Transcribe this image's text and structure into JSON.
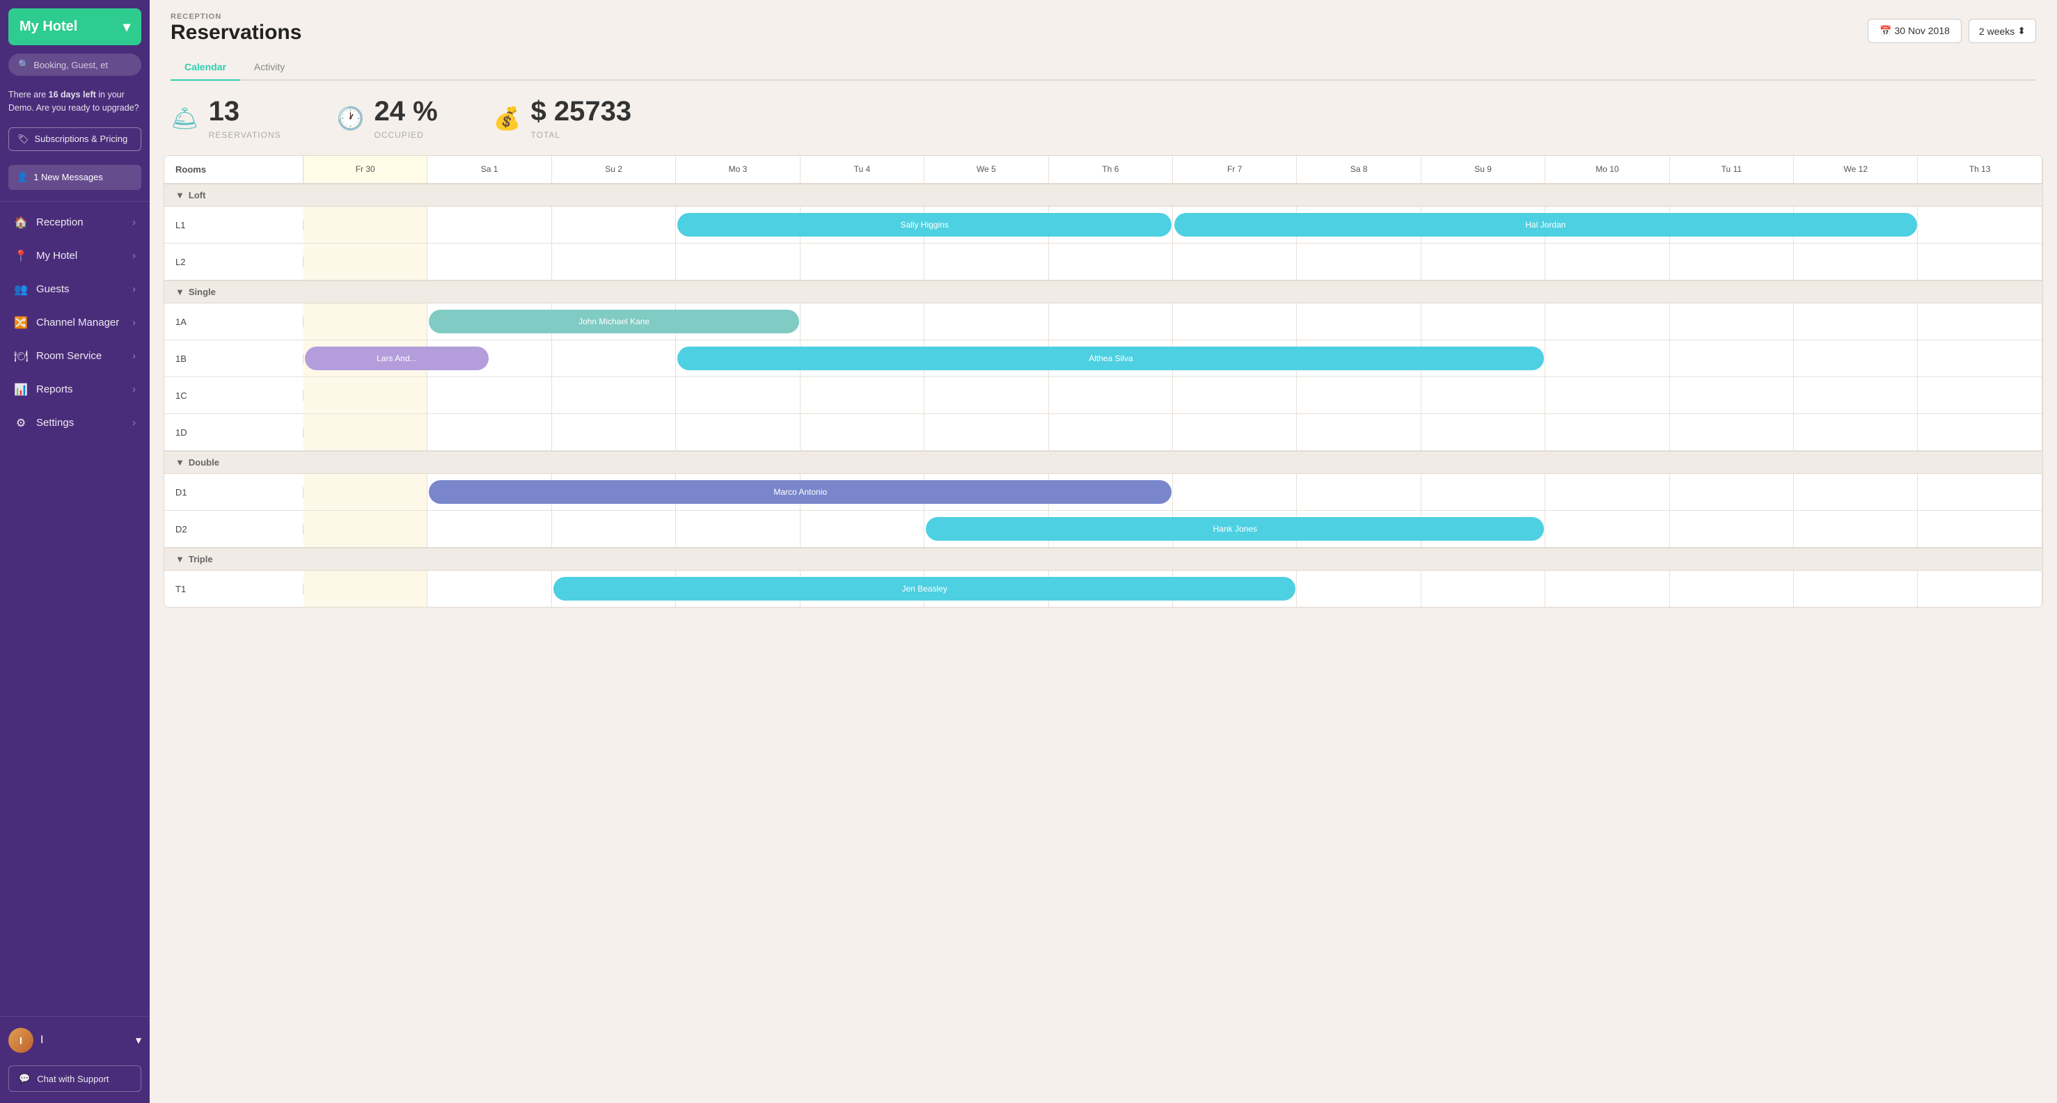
{
  "sidebar": {
    "hotel_name": "My Hotel",
    "search_placeholder": "Booking, Guest, et",
    "demo_notice": "There are ",
    "demo_days": "16 days left",
    "demo_suffix": " in your Demo. Are you ready to upgrade?",
    "subscriptions_label": "Subscriptions & Pricing",
    "messages_label": "1 New Messages",
    "nav_items": [
      {
        "id": "reception",
        "label": "Reception",
        "icon": "🏠"
      },
      {
        "id": "my-hotel",
        "label": "My Hotel",
        "icon": "📍"
      },
      {
        "id": "guests",
        "label": "Guests",
        "icon": "👥"
      },
      {
        "id": "channel-manager",
        "label": "Channel Manager",
        "icon": "🔀"
      },
      {
        "id": "room-service",
        "label": "Room Service",
        "icon": "🍽"
      },
      {
        "id": "reports",
        "label": "Reports",
        "icon": "📊"
      },
      {
        "id": "settings",
        "label": "Settings",
        "icon": "⚙"
      }
    ],
    "user_label": "I",
    "chat_support_label": "Chat with Support"
  },
  "header": {
    "section_label": "RECEPTION",
    "page_title": "Reservations",
    "date_value": "30 Nov 2018",
    "week_value": "2 weeks"
  },
  "tabs": [
    {
      "id": "calendar",
      "label": "Calendar",
      "active": true
    },
    {
      "id": "activity",
      "label": "Activity",
      "active": false
    }
  ],
  "stats": {
    "reservations_count": "13",
    "reservations_label": "RESERVATIONS",
    "occupied_percent": "24 %",
    "occupied_label": "OCCUPIED",
    "total_amount": "$ 25733",
    "total_label": "TOTAL"
  },
  "calendar": {
    "rooms_header": "Rooms",
    "days": [
      {
        "label": "Fr 30",
        "today": true
      },
      {
        "label": "Sa 1",
        "today": false
      },
      {
        "label": "Su 2",
        "today": false
      },
      {
        "label": "Mo 3",
        "today": false
      },
      {
        "label": "Tu 4",
        "today": false
      },
      {
        "label": "We 5",
        "today": false
      },
      {
        "label": "Th 6",
        "today": false
      },
      {
        "label": "Fr 7",
        "today": false
      },
      {
        "label": "Sa 8",
        "today": false
      },
      {
        "label": "Su 9",
        "today": false
      },
      {
        "label": "Mo 10",
        "today": false
      },
      {
        "label": "Tu 11",
        "today": false
      },
      {
        "label": "We 12",
        "today": false
      },
      {
        "label": "Th 13",
        "today": false
      }
    ],
    "groups": [
      {
        "name": "Loft",
        "rooms": [
          {
            "id": "L1",
            "bookings": [
              {
                "guest": "Sally Higgins",
                "start": 3,
                "span": 4,
                "color": "booking-cyan"
              },
              {
                "guest": "Hal Jordan",
                "start": 7,
                "span": 6,
                "color": "booking-cyan"
              }
            ]
          },
          {
            "id": "L2",
            "bookings": []
          }
        ]
      },
      {
        "name": "Single",
        "rooms": [
          {
            "id": "1A",
            "bookings": [
              {
                "guest": "John Michael Kane",
                "start": 1,
                "span": 3,
                "color": "booking-green"
              }
            ]
          },
          {
            "id": "1B",
            "bookings": [
              {
                "guest": "Lars And...",
                "start": 0,
                "span": 1.5,
                "color": "booking-lavender"
              },
              {
                "guest": "Althea Silva",
                "start": 3,
                "span": 7,
                "color": "booking-cyan"
              }
            ]
          },
          {
            "id": "1C",
            "bookings": []
          },
          {
            "id": "1D",
            "bookings": []
          }
        ]
      },
      {
        "name": "Double",
        "rooms": [
          {
            "id": "D1",
            "bookings": [
              {
                "guest": "Marco Antonio",
                "start": 1,
                "span": 6,
                "color": "booking-indigo"
              }
            ]
          },
          {
            "id": "D2",
            "bookings": [
              {
                "guest": "Hank Jones",
                "start": 5,
                "span": 5,
                "color": "booking-cyan"
              }
            ]
          }
        ]
      },
      {
        "name": "Triple",
        "rooms": [
          {
            "id": "T1",
            "bookings": [
              {
                "guest": "Jen Beasley",
                "start": 2,
                "span": 6,
                "color": "booking-cyan"
              }
            ]
          }
        ]
      }
    ]
  }
}
